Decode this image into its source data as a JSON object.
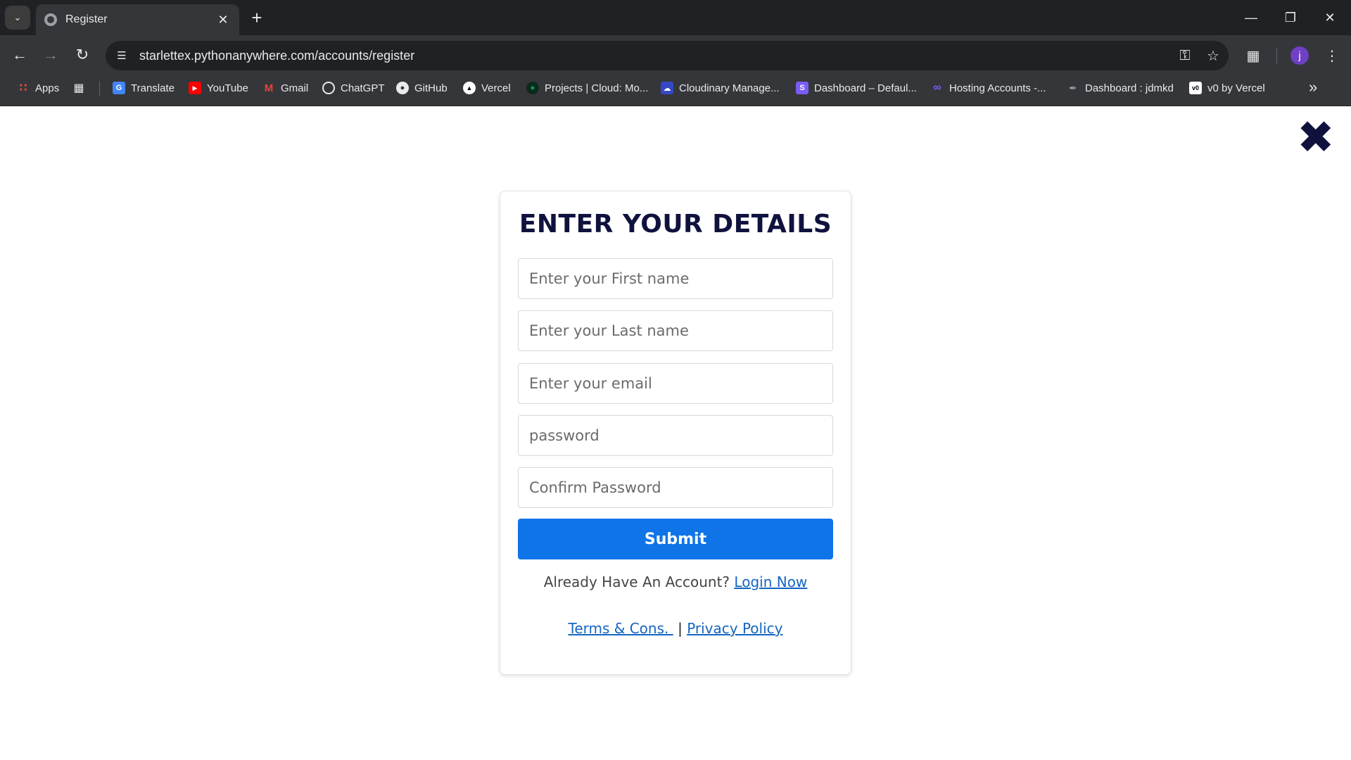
{
  "browser": {
    "tab_title": "Register",
    "url": "starlettex.pythonanywhere.com/accounts/register",
    "profile_initial": "j",
    "bookmarks": [
      {
        "label": "Apps",
        "icon": "apps-grid-icon",
        "color": "#ea4335"
      },
      {
        "label": "",
        "icon": "tab-groups-icon",
        "color": "#e8eaed"
      },
      {
        "label": "Translate",
        "icon": "google-translate-icon",
        "color": "#4285f4"
      },
      {
        "label": "YouTube",
        "icon": "youtube-icon",
        "color": "#ff0000"
      },
      {
        "label": "Gmail",
        "icon": "gmail-icon",
        "color": "#ea4335"
      },
      {
        "label": "ChatGPT",
        "icon": "chatgpt-icon",
        "color": "#ffffff"
      },
      {
        "label": "GitHub",
        "icon": "github-icon",
        "color": "#ffffff"
      },
      {
        "label": "Vercel",
        "icon": "vercel-icon",
        "color": "#000000"
      },
      {
        "label": "Projects | Cloud: Mo...",
        "icon": "mongodb-leaf-icon",
        "color": "#00a35c"
      },
      {
        "label": "Cloudinary Manage...",
        "icon": "cloudinary-icon",
        "color": "#3448c5"
      },
      {
        "label": "Dashboard – Defaul...",
        "icon": "stripe-s-icon",
        "color": "#7b5cf5"
      },
      {
        "label": "Hosting Accounts -...",
        "icon": "infinity-icon",
        "color": "#7b5cf5"
      },
      {
        "label": "Dashboard : jdmkd",
        "icon": "pen-nib-icon",
        "color": "#9aa0a6"
      },
      {
        "label": "v0 by Vercel",
        "icon": "v0-icon",
        "color": "#ffffff"
      }
    ]
  },
  "page": {
    "close_glyph": "✖",
    "form": {
      "title": "ENTER YOUR DETAILS",
      "first_name_placeholder": "Enter your First name",
      "last_name_placeholder": "Enter your Last name",
      "email_placeholder": "Enter your email",
      "password_placeholder": "password",
      "confirm_password_placeholder": "Confirm Password",
      "submit_label": "Submit",
      "account_prompt": "Already Have An Account?",
      "login_link": "Login Now",
      "terms_link": "Terms & Cons. ",
      "separator": "|",
      "privacy_link": "Privacy Policy"
    },
    "colors": {
      "title": "#10123e",
      "submit_bg": "#0f74e8",
      "link": "#1565c0"
    }
  }
}
